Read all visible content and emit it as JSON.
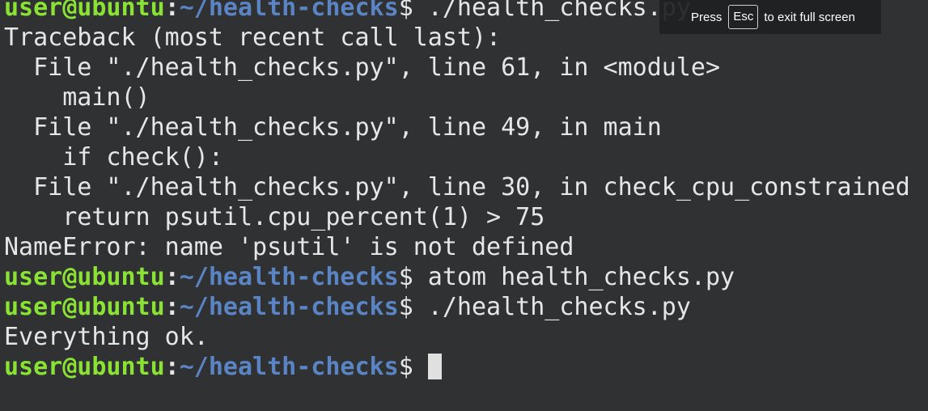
{
  "overlay": {
    "press_label": "Press",
    "key_label": "Esc",
    "suffix_label": "to exit full screen"
  },
  "prompt": {
    "user": "user@ubuntu",
    "colon": ":",
    "path": "~/health-checks",
    "dollar": "$"
  },
  "lines": {
    "l0": {
      "command": " ./health_checks.py"
    },
    "l1": {
      "text": "Traceback (most recent call last):"
    },
    "l2": {
      "text": "  File \"./health_checks.py\", line 61, in <module>"
    },
    "l3": {
      "text": "    main()"
    },
    "l4": {
      "text": "  File \"./health_checks.py\", line 49, in main"
    },
    "l5": {
      "text": "    if check():"
    },
    "l6": {
      "text": "  File \"./health_checks.py\", line 30, in check_cpu_constrained"
    },
    "l7": {
      "text": "    return psutil.cpu_percent(1) > 75"
    },
    "l8": {
      "text": "NameError: name 'psutil' is not defined"
    },
    "l9": {
      "command": " atom health_checks.py"
    },
    "l10": {
      "command": " ./health_checks.py"
    },
    "l11": {
      "text": "Everything ok."
    },
    "l12": {
      "command": " "
    }
  }
}
